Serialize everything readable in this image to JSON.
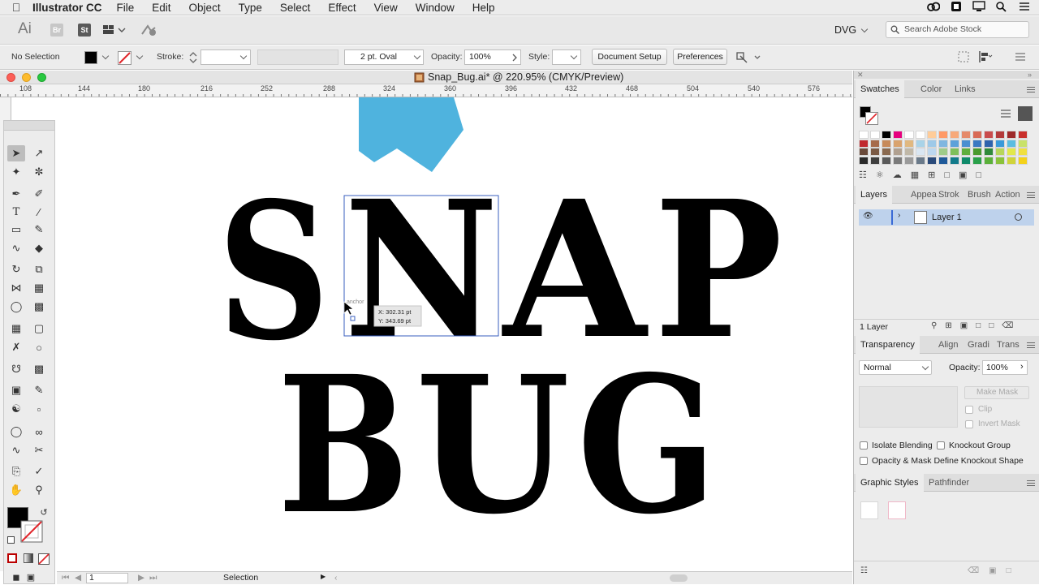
{
  "menubar": {
    "app_name": "Illustrator CC",
    "items": [
      "File",
      "Edit",
      "Object",
      "Type",
      "Select",
      "Effect",
      "View",
      "Window",
      "Help"
    ]
  },
  "appbar": {
    "app_icon": "Ai",
    "bridge_badge": "Br",
    "stock_badge": "St",
    "workspace": "DVG",
    "search_placeholder": "Search Adobe Stock"
  },
  "control_bar": {
    "selection_status": "No Selection",
    "stroke_label": "Stroke:",
    "brush_value": "2 pt. Oval",
    "opacity_label": "Opacity:",
    "opacity_value": "100%",
    "style_label": "Style:",
    "document_setup": "Document Setup",
    "preferences": "Preferences"
  },
  "document": {
    "title": "Snap_Bug.ai* @ 220.95% (CMYK/Preview)",
    "ruler_ticks": [
      "108",
      "144",
      "180",
      "216",
      "252",
      "288",
      "324",
      "360",
      "396",
      "432",
      "468",
      "504",
      "540",
      "576"
    ]
  },
  "artwork": {
    "line1": [
      "S",
      "N",
      "A",
      "P"
    ],
    "line2": [
      "B",
      "U",
      "G"
    ],
    "shape_color": "#4fb3de",
    "text_color": "#000000",
    "snap_hint": "anchor",
    "coord_x": "X: 302.31 pt",
    "coord_y": "Y: 343.69 pt"
  },
  "status_bar": {
    "artboard": "1",
    "tool_status": "Selection"
  },
  "swatches_panel": {
    "tabs": [
      "Swatches",
      "Color",
      "Links"
    ],
    "colors": [
      [
        "#ffffff",
        "#ffffff",
        "#000000",
        "#e6007e",
        "#ffffff",
        "#ffffff",
        "#ffcc99",
        "#ff9966",
        "#f7a97a",
        "#e58a6a",
        "#d86a55",
        "#c94b4b",
        "#b33a3a",
        "#9e2a2a",
        "#c9302c"
      ],
      [
        "#c0282d",
        "#a66a4a",
        "#c78a5a",
        "#d9a36e",
        "#e0b880",
        "#a9d3e8",
        "#9ec9e8",
        "#7fb6e0",
        "#5ca1d9",
        "#4a8fd0",
        "#3c79c2",
        "#2e63ad",
        "#3a9ad9",
        "#5bbde0",
        "#c9e26a"
      ],
      [
        "#6a4a3a",
        "#7a5a45",
        "#8a6a50",
        "#b0a090",
        "#c0b8a8",
        "#d9e6f2",
        "#bcd7ef",
        "#9ecb8a",
        "#7fbf5a",
        "#5fae3e",
        "#4a9a2e",
        "#2f8a3a",
        "#b7d65a",
        "#e2e84a",
        "#f0e040"
      ],
      [
        "#2a2a2a",
        "#3e3e3e",
        "#5a5a5a",
        "#7a7a7a",
        "#9a9a9a",
        "#6a7a8a",
        "#2a4a7a",
        "#1f5a9a",
        "#117a8a",
        "#0f8a6a",
        "#2aa04a",
        "#5ab03a",
        "#8ac23a",
        "#d0d43a",
        "#f4d21a"
      ]
    ]
  },
  "layers_panel": {
    "tabs": [
      "Layers",
      "Appea",
      "Strok",
      "Brush",
      "Action"
    ],
    "layer_name": "Layer 1",
    "count": "1 Layer"
  },
  "transparency_panel": {
    "tabs": [
      "Transparency",
      "Align",
      "Gradi",
      "Trans"
    ],
    "blend_mode": "Normal",
    "opacity_label": "Opacity:",
    "opacity_value": "100%",
    "make_mask": "Make Mask",
    "clip": "Clip",
    "invert_mask": "Invert Mask",
    "isolate_blending": "Isolate Blending",
    "knockout_group": "Knockout Group",
    "opacity_mask_define": "Opacity & Mask Define Knockout Shape"
  },
  "graphic_styles_panel": {
    "tabs": [
      "Graphic Styles",
      "Pathfinder"
    ]
  }
}
